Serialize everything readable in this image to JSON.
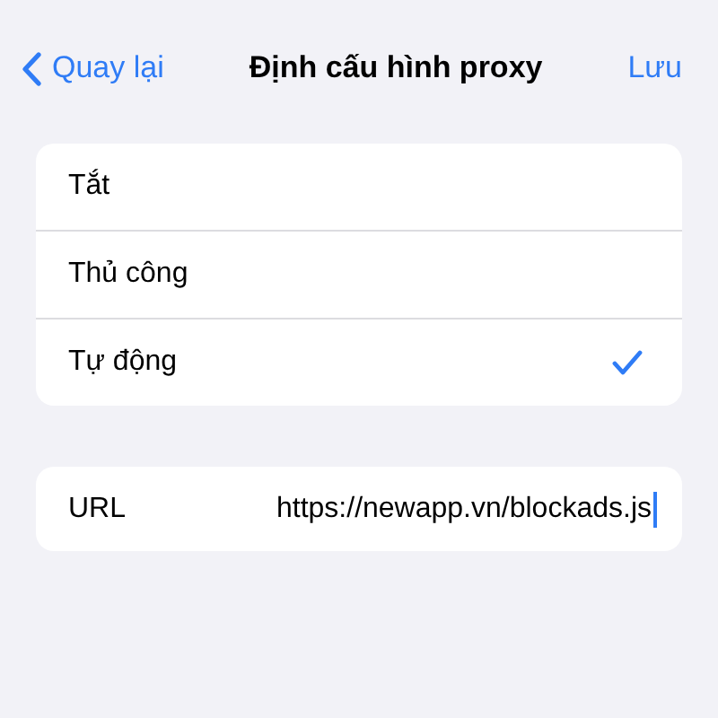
{
  "nav": {
    "back": "Quay lại",
    "title": "Định cấu hình proxy",
    "save": "Lưu"
  },
  "options": [
    {
      "label": "Tắt",
      "selected": false
    },
    {
      "label": "Thủ công",
      "selected": false
    },
    {
      "label": "Tự động",
      "selected": true
    }
  ],
  "url": {
    "label": "URL",
    "value": "https://newapp.vn/blockads.js",
    "focused": true
  }
}
